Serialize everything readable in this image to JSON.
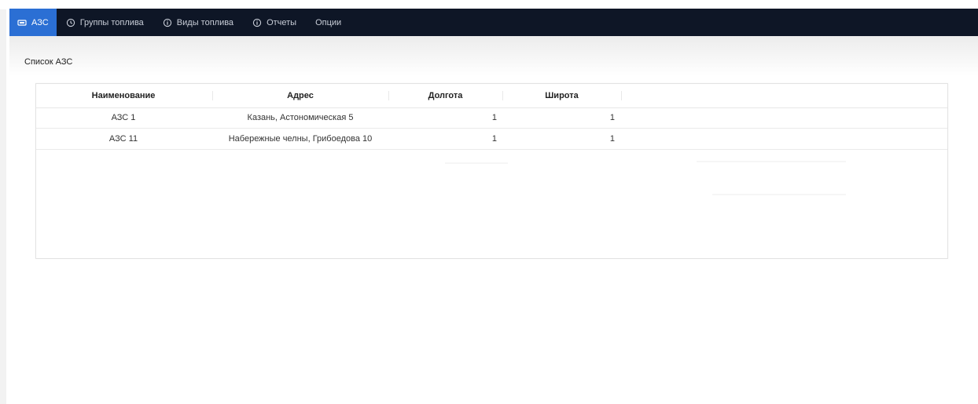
{
  "nav": {
    "tabs": [
      {
        "label": "АЗС",
        "icon": "station-icon",
        "active": true
      },
      {
        "label": "Группы топлива",
        "icon": "clock-icon",
        "active": false
      },
      {
        "label": "Виды топлива",
        "icon": "info-icon",
        "active": false
      },
      {
        "label": "Отчеты",
        "icon": "info-icon",
        "active": false
      },
      {
        "label": "Опции",
        "icon": "",
        "active": false
      }
    ]
  },
  "page": {
    "title": "Список АЗС"
  },
  "table": {
    "columns": [
      "Наименование",
      "Адрес",
      "Долгота",
      "Широта"
    ],
    "rows": [
      {
        "name": "АЗС 1",
        "address": "Казань, Астономическая 5",
        "longitude": "1",
        "latitude": "1"
      },
      {
        "name": "АЗС 11",
        "address": "Набережные челны, Грибоедова 10",
        "longitude": "1",
        "latitude": "1"
      }
    ]
  },
  "colors": {
    "topbar": "#0e1626",
    "active_tab": "#2b6fd4",
    "tab_text": "#c9ced8"
  }
}
